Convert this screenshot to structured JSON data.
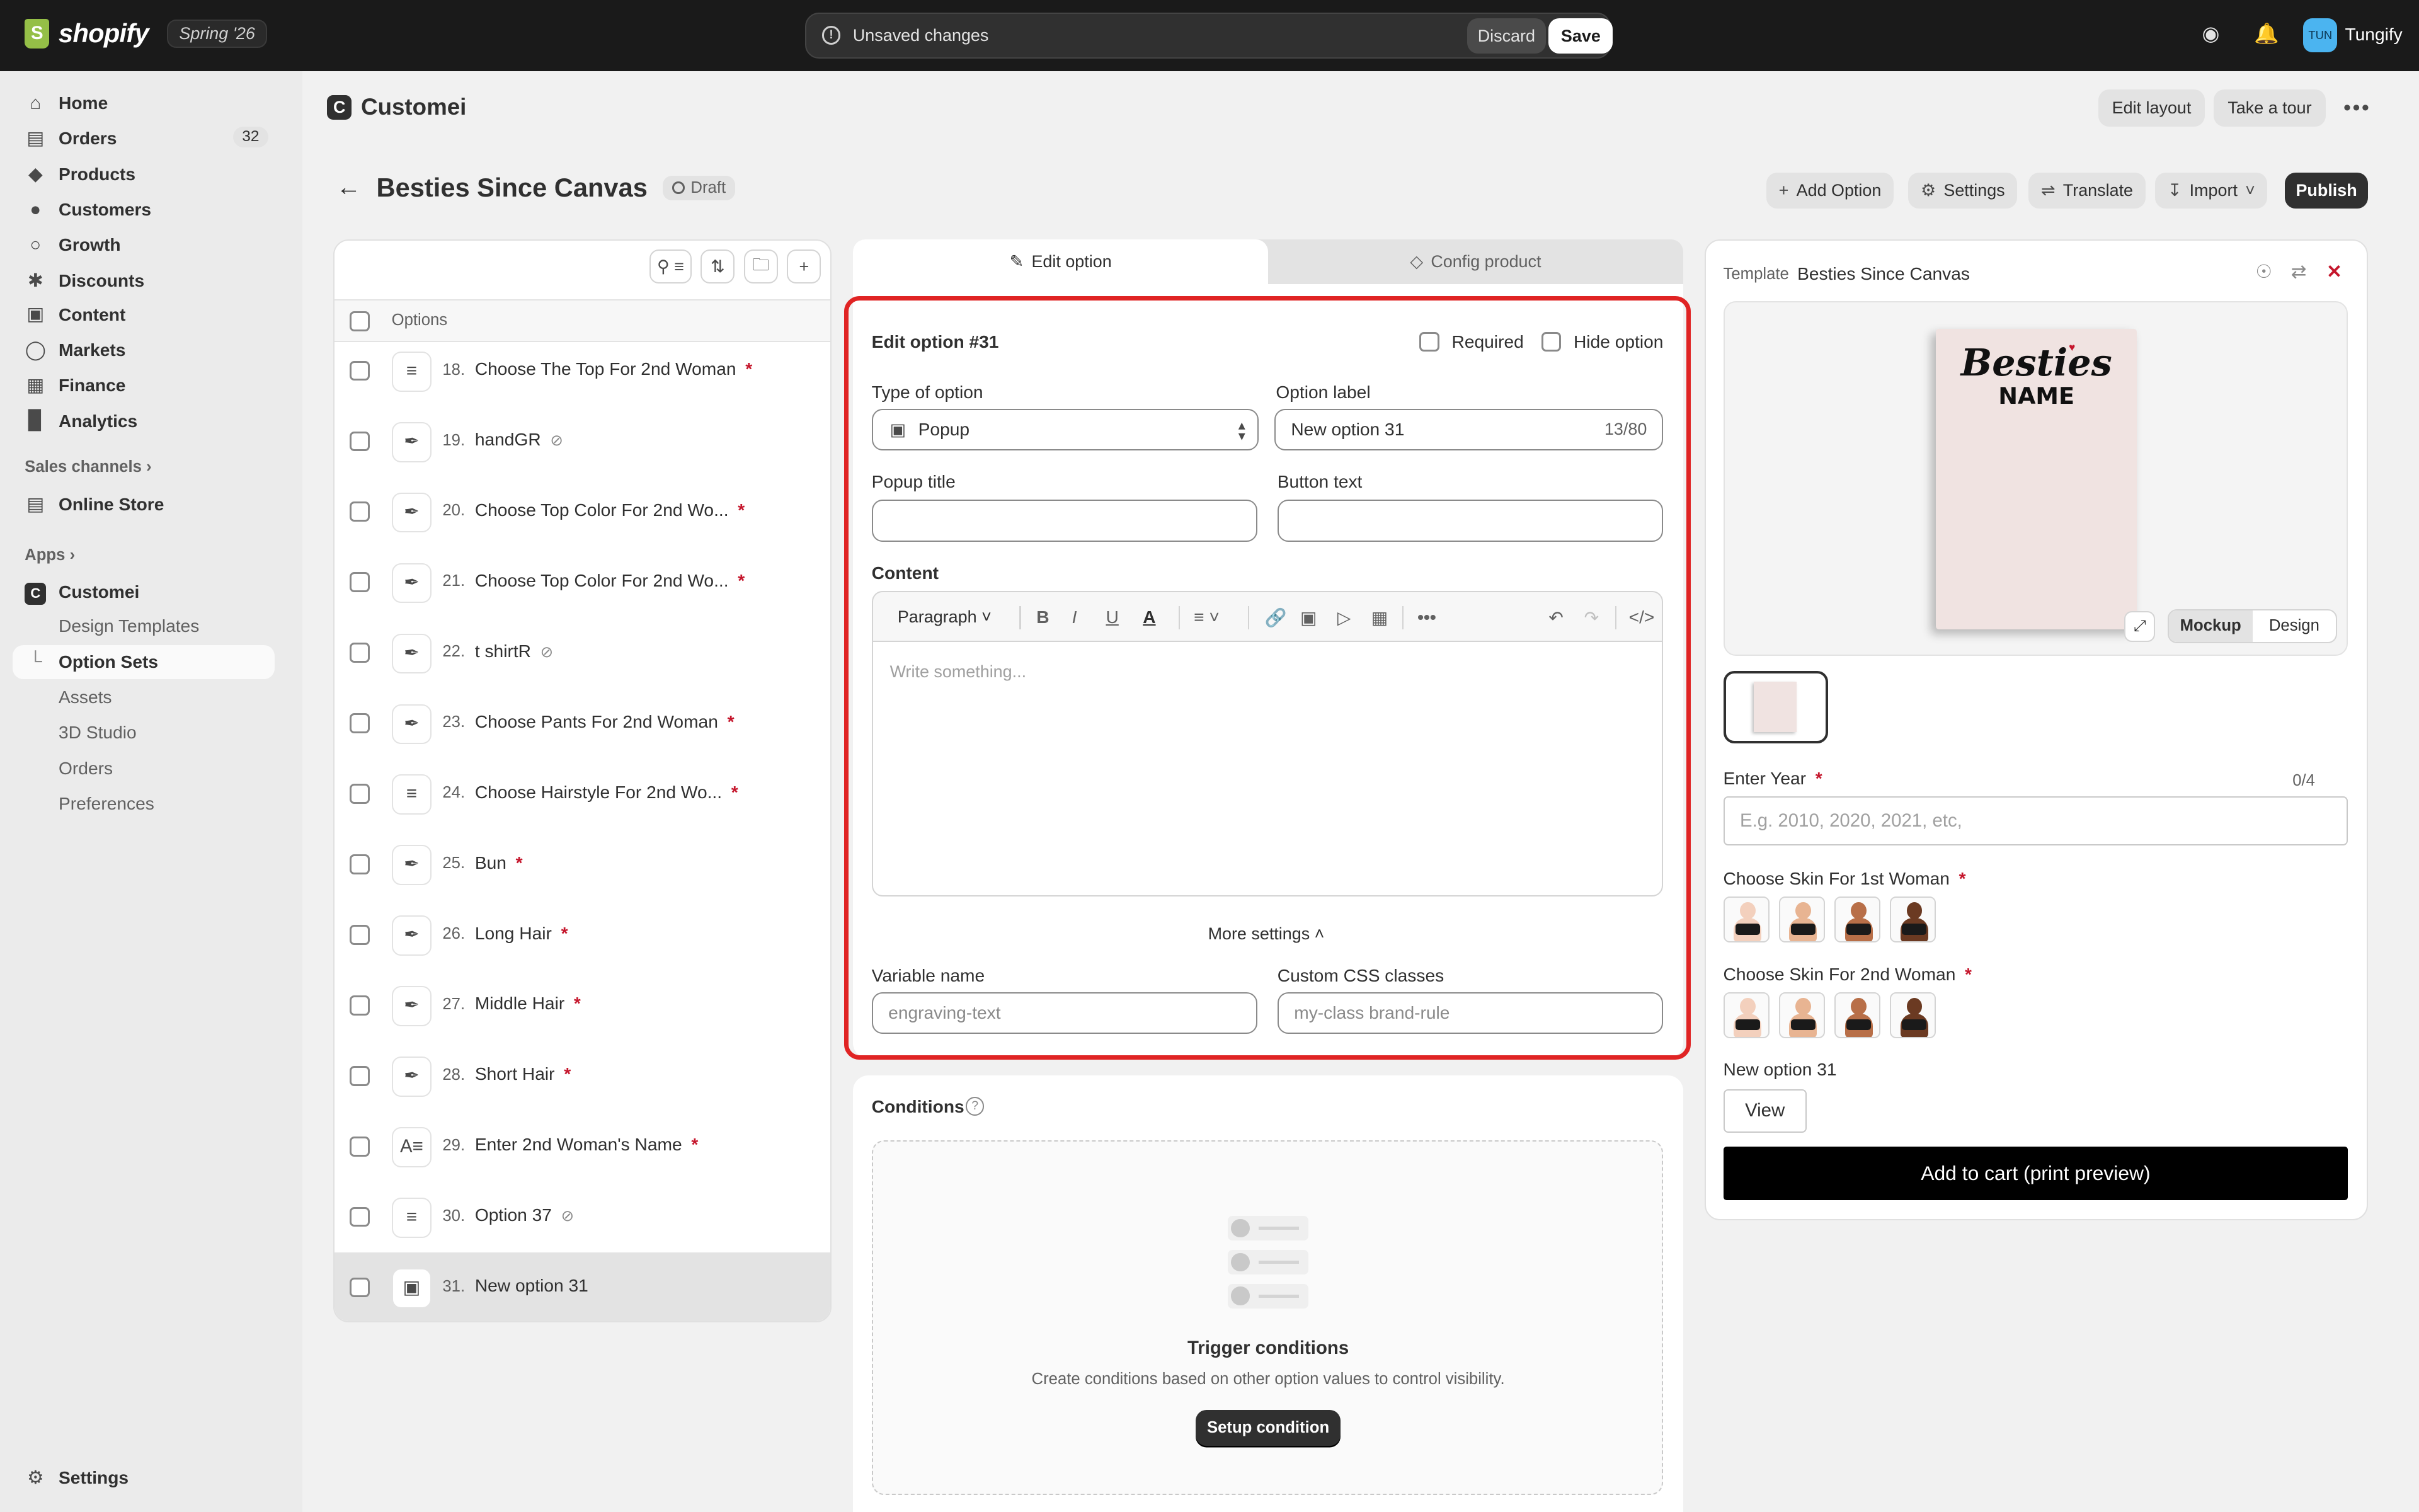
{
  "topbar": {
    "brand": "shopify",
    "edition": "Spring '26",
    "unsaved_message": "Unsaved changes",
    "discard_label": "Discard",
    "save_label": "Save",
    "avatar_initials": "TUN",
    "store_name": "Tungify"
  },
  "sidebar": {
    "items": [
      {
        "label": "Home",
        "icon": "home-icon"
      },
      {
        "label": "Orders",
        "icon": "inbox-icon",
        "badge": "32"
      },
      {
        "label": "Products",
        "icon": "tag-icon"
      },
      {
        "label": "Customers",
        "icon": "person-icon"
      },
      {
        "label": "Growth",
        "icon": "growth-icon"
      },
      {
        "label": "Discounts",
        "icon": "discount-icon"
      },
      {
        "label": "Content",
        "icon": "content-icon"
      },
      {
        "label": "Markets",
        "icon": "globe-icon"
      },
      {
        "label": "Finance",
        "icon": "bank-icon"
      },
      {
        "label": "Analytics",
        "icon": "chart-icon"
      }
    ],
    "sales_channels_title": "Sales channels",
    "online_store": "Online Store",
    "apps_title": "Apps",
    "app_name": "Customei",
    "app_items": [
      "Design Templates",
      "Option Sets",
      "Assets",
      "3D Studio",
      "Orders",
      "Preferences"
    ],
    "settings": "Settings"
  },
  "app_header": {
    "name": "Customei",
    "edit_layout": "Edit layout",
    "take_tour": "Take a tour"
  },
  "page": {
    "title": "Besties Since Canvas",
    "status": "Draft",
    "actions": {
      "add_option": "Add Option",
      "settings": "Settings",
      "translate": "Translate",
      "import": "Import",
      "publish": "Publish"
    }
  },
  "options_list": {
    "header": "Options",
    "rows": [
      {
        "num": "18.",
        "label": "Choose The Top For 2nd Woman",
        "required": true,
        "hidden": false,
        "icon": "list-icon"
      },
      {
        "num": "19.",
        "label": "handGR",
        "required": false,
        "hidden": true,
        "icon": "paint-icon"
      },
      {
        "num": "20.",
        "label": "Choose Top Color For 2nd Wo...",
        "required": true,
        "hidden": false,
        "icon": "paint-icon"
      },
      {
        "num": "21.",
        "label": "Choose Top Color For 2nd Wo...",
        "required": true,
        "hidden": false,
        "icon": "paint-icon"
      },
      {
        "num": "22.",
        "label": "t shirtR",
        "required": false,
        "hidden": true,
        "icon": "paint-icon"
      },
      {
        "num": "23.",
        "label": "Choose Pants For 2nd Woman",
        "required": true,
        "hidden": false,
        "icon": "paint-icon"
      },
      {
        "num": "24.",
        "label": "Choose Hairstyle For 2nd Wo...",
        "required": true,
        "hidden": false,
        "icon": "list-icon"
      },
      {
        "num": "25.",
        "label": "Bun",
        "required": true,
        "hidden": false,
        "icon": "paint-icon"
      },
      {
        "num": "26.",
        "label": "Long Hair",
        "required": true,
        "hidden": false,
        "icon": "paint-icon"
      },
      {
        "num": "27.",
        "label": "Middle Hair",
        "required": true,
        "hidden": false,
        "icon": "paint-icon"
      },
      {
        "num": "28.",
        "label": "Short Hair",
        "required": true,
        "hidden": false,
        "icon": "paint-icon"
      },
      {
        "num": "29.",
        "label": "Enter 2nd Woman's Name",
        "required": true,
        "hidden": false,
        "icon": "text-icon"
      },
      {
        "num": "30.",
        "label": "Option 37",
        "required": false,
        "hidden": true,
        "icon": "list-icon"
      },
      {
        "num": "31.",
        "label": "New option 31",
        "required": false,
        "hidden": false,
        "icon": "popup-icon",
        "selected": true
      }
    ]
  },
  "editor": {
    "tab_edit": "Edit option",
    "tab_config": "Config product",
    "heading": "Edit option #31",
    "required_label": "Required",
    "hide_label": "Hide option",
    "type_label": "Type of option",
    "type_value": "Popup",
    "option_label_label": "Option label",
    "option_label_value": "New option 31",
    "option_label_counter": "13/80",
    "popup_title_label": "Popup title",
    "button_text_label": "Button text",
    "content_label": "Content",
    "paragraph": "Paragraph",
    "content_placeholder": "Write something...",
    "more_settings": "More settings",
    "variable_name_label": "Variable name",
    "variable_name_placeholder": "engraving-text",
    "css_label": "Custom CSS classes",
    "css_placeholder": "my-class brand-rule"
  },
  "conditions": {
    "title": "Conditions",
    "trigger_title": "Trigger conditions",
    "trigger_desc": "Create conditions based on other option values to control visibility.",
    "setup_button": "Setup condition"
  },
  "preview": {
    "template_label": "Template",
    "template_name": "Besties Since Canvas",
    "mock_title": "Besties",
    "mock_subtitle": "NAME",
    "mockup": "Mockup",
    "design": "Design",
    "enter_year_label": "Enter Year",
    "enter_year_counter": "0/4",
    "enter_year_placeholder": "E.g. 2010, 2020, 2021, etc,",
    "skin1_label": "Choose Skin For 1st Woman",
    "skin2_label": "Choose Skin For 2nd Woman",
    "skin_tones": [
      "#f3d0bd",
      "#e8b492",
      "#b86f48",
      "#6b3a22"
    ],
    "new_option_label": "New option 31",
    "view_button": "View",
    "cart_button": "Add to cart (print preview)"
  },
  "colors": {
    "accent_highlight": "#e02424",
    "required_star": "#c5162c",
    "primary_dark": "#303030"
  }
}
